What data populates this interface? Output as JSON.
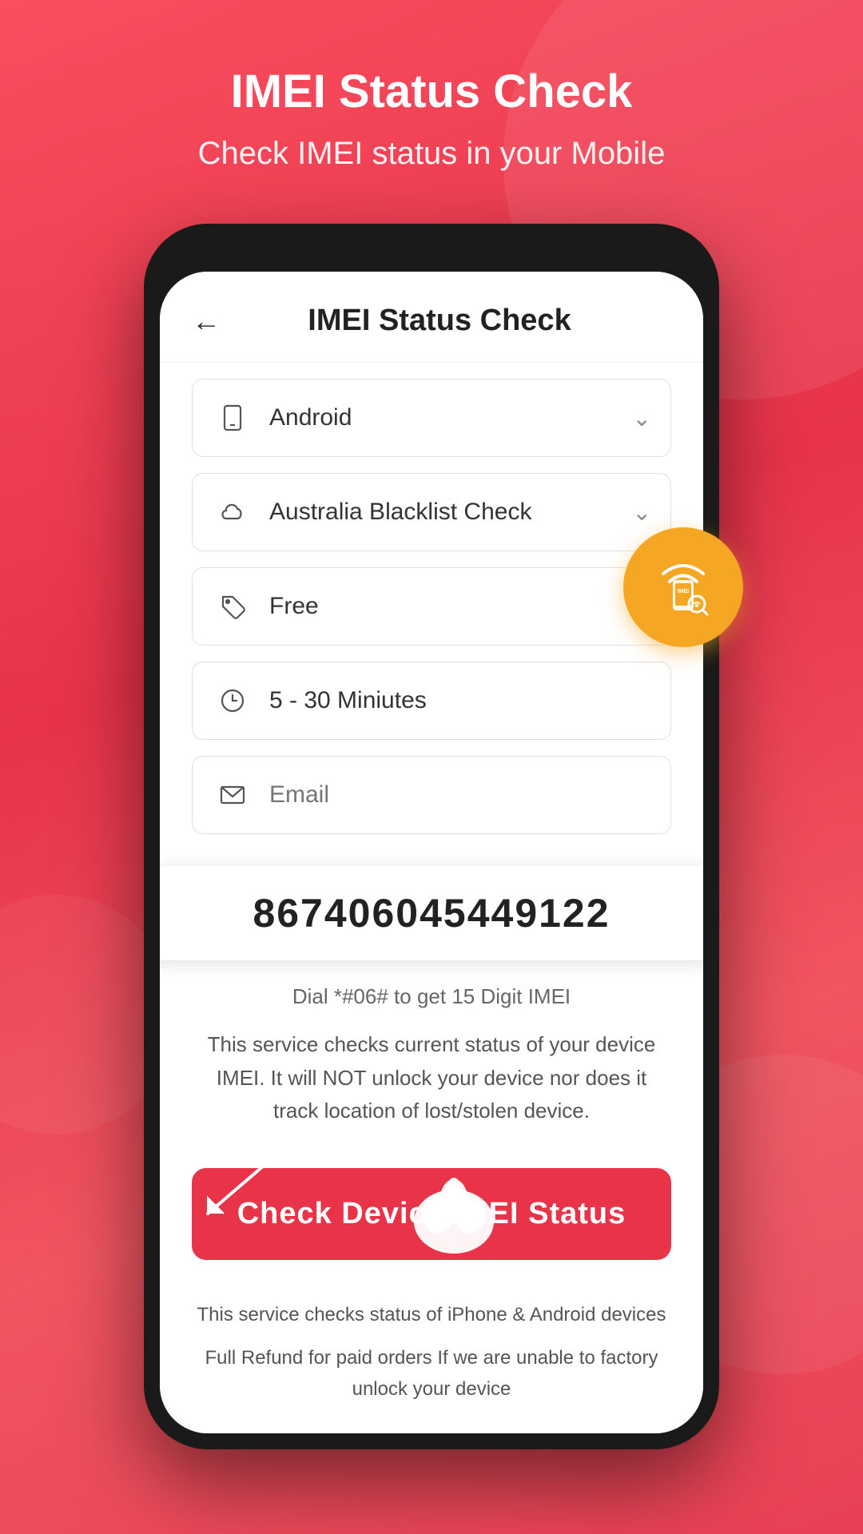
{
  "header": {
    "title": "IMEI Status Check",
    "subtitle": "Check IMEI status in your Mobile"
  },
  "app": {
    "back_label": "←",
    "screen_title": "IMEI Status Check",
    "fields": {
      "device_type": {
        "value": "Android",
        "placeholder": "Android"
      },
      "service": {
        "value": "Australia Blacklist Check",
        "placeholder": "Australia Blacklist Check"
      },
      "price": {
        "value": "Free"
      },
      "duration": {
        "value": "5 - 30 Miniutes"
      },
      "email": {
        "placeholder": "Email"
      }
    },
    "imei_number": "867406045449122",
    "dial_hint": "Dial *#06# to get 15 Digit IMEI",
    "service_info_1": "This service checks current status of your device IMEI. It will NOT unlock your device nor does it track location of lost/stolen device.",
    "check_button_label": "Check Device IMEI Status",
    "service_info_2": "This service checks status of iPhone & Android devices",
    "refund_info": "Full Refund for paid orders If we are unable to factory unlock your device"
  },
  "badge": {
    "label": "IMEI"
  }
}
